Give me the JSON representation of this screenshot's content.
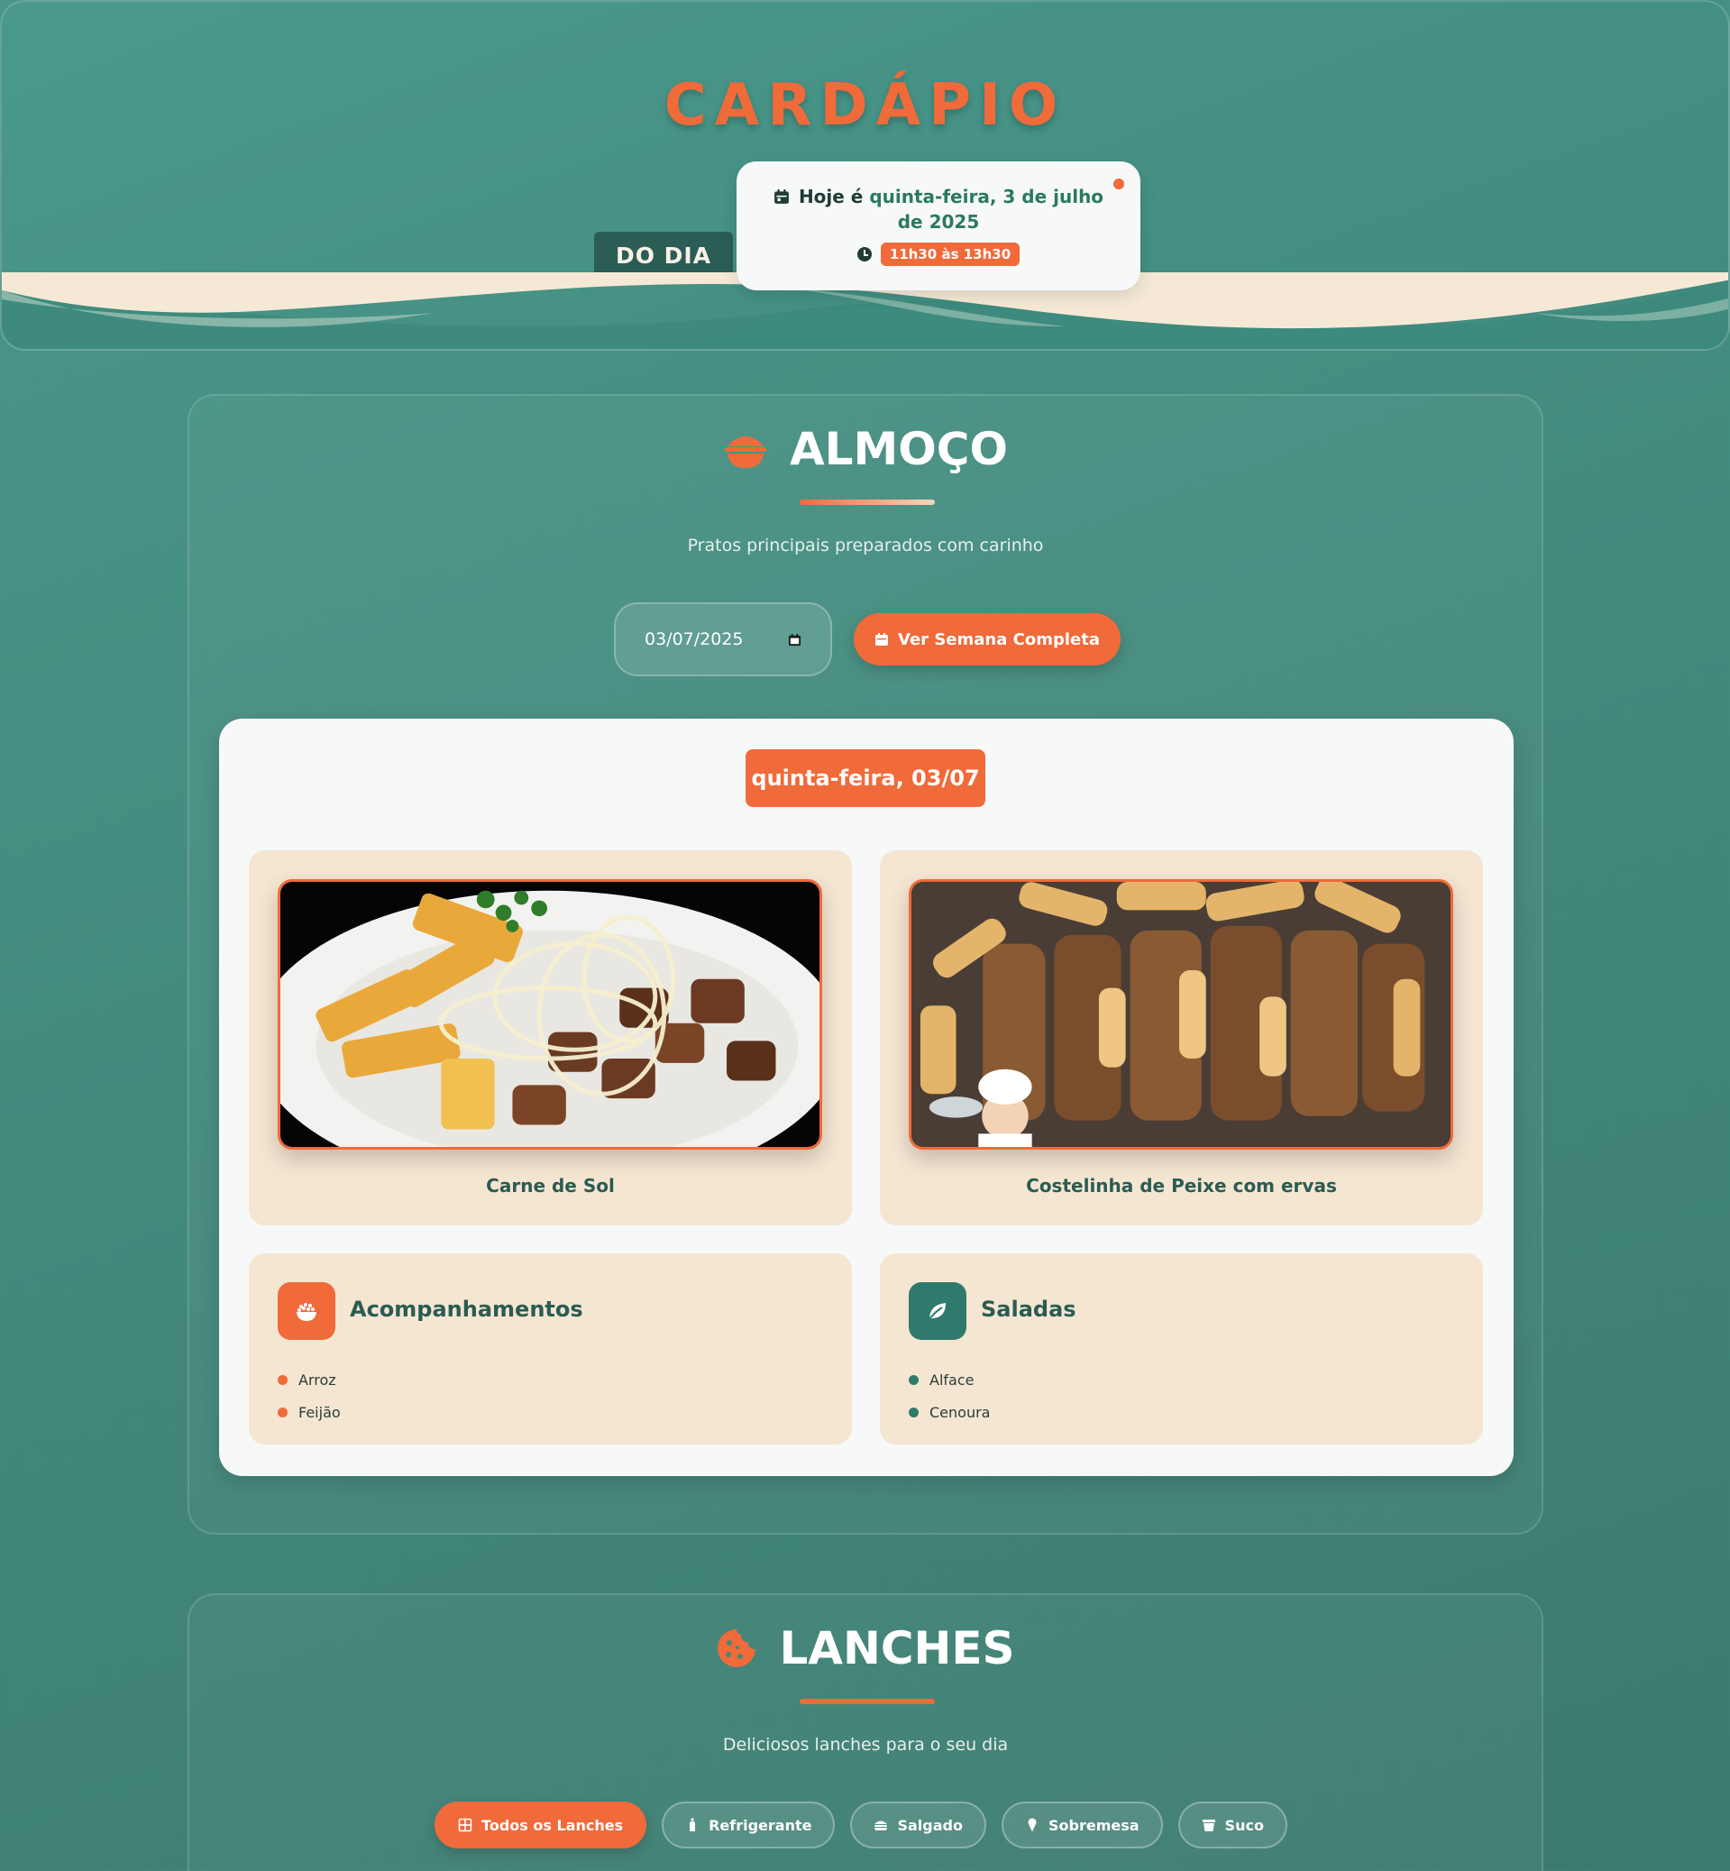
{
  "header": {
    "title": "CARDÁPIO",
    "subtitle_badge": "DO DIA",
    "today": {
      "prefix": "Hoje é",
      "date_text": "quinta-feira, 3 de julho de 2025",
      "time_range": "11h30 às 13h30"
    }
  },
  "almoco": {
    "title": "ALMOÇO",
    "subtitle": "Pratos principais preparados com carinho",
    "date_input_value": "03/07/2025",
    "week_button_label": "Ver Semana Completa",
    "day_badge": "quinta-feira, 03/07",
    "dishes": [
      {
        "name": "Carne de Sol"
      },
      {
        "name": "Costelinha de Peixe com ervas"
      }
    ],
    "acompanhamentos": {
      "title": "Acompanhamentos",
      "items": [
        "Arroz",
        "Feijão"
      ]
    },
    "saladas": {
      "title": "Saladas",
      "items": [
        "Alface",
        "Cenoura"
      ]
    }
  },
  "lanches": {
    "title": "LANCHES",
    "subtitle": "Deliciosos lanches para o seu dia",
    "filters": [
      {
        "label": "Todos os Lanches",
        "icon": "grid-icon",
        "active": true
      },
      {
        "label": "Refrigerante",
        "icon": "bottle-icon",
        "active": false
      },
      {
        "label": "Salgado",
        "icon": "burger-icon",
        "active": false
      },
      {
        "label": "Sobremesa",
        "icon": "ice-cream-icon",
        "active": false
      },
      {
        "label": "Suco",
        "icon": "cup-icon",
        "active": false
      }
    ]
  },
  "colors": {
    "accent": "#f06a3a",
    "background": "#43897c",
    "dark_green": "#2b5d55",
    "cream": "#f5e6d2"
  }
}
